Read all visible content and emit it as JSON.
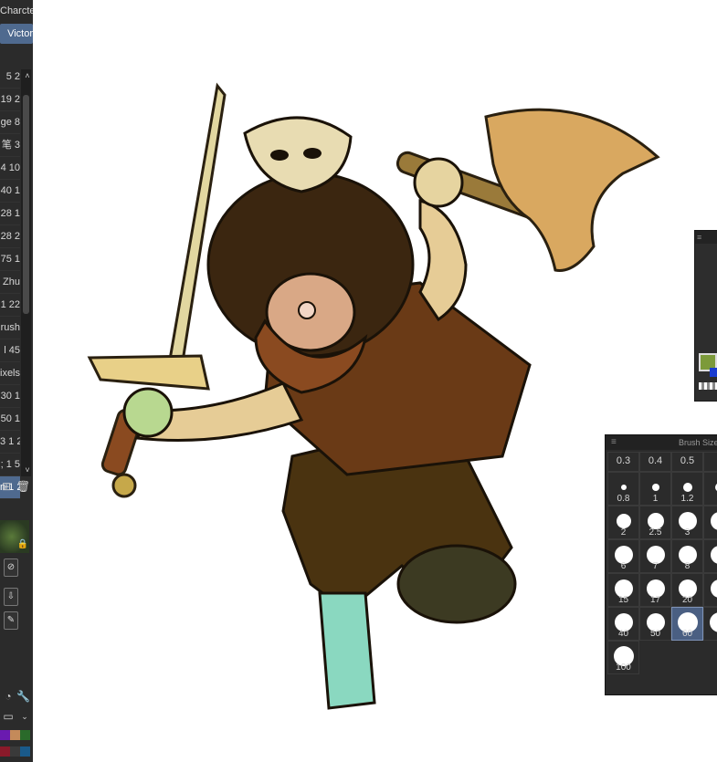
{
  "left_panel": {
    "tabs": [
      {
        "label": "Charcter",
        "selected": false
      },
      {
        "label": "Victor",
        "selected": true
      }
    ],
    "brush_rows": [
      {
        "label": "5 2"
      },
      {
        "label": "19 2"
      },
      {
        "label": "ge 8"
      },
      {
        "label": "笔 3"
      },
      {
        "label": "4 10"
      },
      {
        "label": "40 1"
      },
      {
        "label": "28 1"
      },
      {
        "label": "28 2"
      },
      {
        "label": "75 1"
      },
      {
        "label": "Zhu"
      },
      {
        "label": "1 22"
      },
      {
        "label": "rush"
      },
      {
        "label": "l 45"
      },
      {
        "label": "ixels"
      },
      {
        "label": "30 1"
      },
      {
        "label": "50 1"
      },
      {
        "label": "3 1 2"
      },
      {
        "label": "; 1 5"
      },
      {
        "label": "n 1 2",
        "selected": true
      }
    ]
  },
  "brush_size_panel": {
    "title": "Brush Size",
    "top_row": [
      "0.3",
      "0.4",
      "0.5"
    ],
    "sizes": [
      {
        "label": "0.8"
      },
      {
        "label": "1"
      },
      {
        "label": "1.2"
      },
      {
        "label": "2"
      },
      {
        "label": "2.5"
      },
      {
        "label": "3"
      },
      {
        "label": "6"
      },
      {
        "label": "7"
      },
      {
        "label": "8"
      },
      {
        "label": "15"
      },
      {
        "label": "17"
      },
      {
        "label": "20"
      },
      {
        "label": "40"
      },
      {
        "label": "50"
      },
      {
        "label": "60",
        "selected": true
      },
      {
        "label": "100"
      }
    ]
  },
  "colors": {
    "panel_bg": "#2b2b2b",
    "selection": "#4f6a8f",
    "main_color": "#7c9a3a",
    "sub_color": "#1a3cd0"
  },
  "swatches": [
    "#6a1ab0",
    "#c48a5a",
    "#2a6a2a",
    "#8a1a2a",
    "#3a3a3a",
    "#1a5a8a",
    "#c8c8c8",
    "#5a2a1a",
    "#2a2a6a"
  ]
}
